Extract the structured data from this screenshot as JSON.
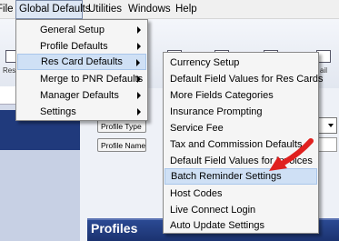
{
  "menubar": {
    "items": [
      {
        "label": "File"
      },
      {
        "label": "Global Defaults"
      },
      {
        "label": "Utilities"
      },
      {
        "label": "Windows"
      },
      {
        "label": "Help"
      }
    ]
  },
  "toolbar": {
    "res_label": "Res",
    "mail_label": "ail"
  },
  "profile_form": {
    "profile_type_label": "Profile Type",
    "profile_name_label": "Profile Name"
  },
  "profiles_panel": {
    "title": "Profiles"
  },
  "global_defaults_menu": {
    "items": [
      {
        "label": "General Setup",
        "submenu": true
      },
      {
        "label": "Profile Defaults",
        "submenu": true
      },
      {
        "label": "Res Card Defaults",
        "submenu": true,
        "active": true
      },
      {
        "label": "Merge to PNR Defaults",
        "submenu": true
      },
      {
        "label": "Manager Defaults",
        "submenu": true
      },
      {
        "label": "Settings",
        "submenu": true
      }
    ]
  },
  "res_card_defaults_menu": {
    "items": [
      {
        "label": "Currency Setup"
      },
      {
        "label": "Default Field Values for Res Cards"
      },
      {
        "label": "More Fields Categories"
      },
      {
        "label": "Insurance Prompting"
      },
      {
        "label": "Service Fee"
      },
      {
        "label": "Tax and Commission Defaults"
      },
      {
        "label": "Default Field Values for Invoices"
      },
      {
        "label": "Batch Reminder Settings",
        "highlighted": true
      },
      {
        "label": "Host Codes"
      },
      {
        "label": "Live Connect Login"
      },
      {
        "label": "Auto Update Settings"
      }
    ]
  },
  "annotation": {
    "arrow_color": "#e0201e"
  }
}
